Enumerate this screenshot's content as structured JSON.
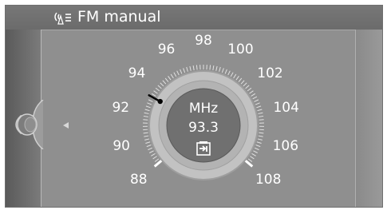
{
  "header": {
    "title": "FM manual",
    "icon": "radio-signal-icon"
  },
  "dial": {
    "unit": "MHz",
    "frequency": "93.3",
    "current_frequency_value": 93.3,
    "scale_labels": [
      "88",
      "90",
      "92",
      "94",
      "96",
      "98",
      "100",
      "102",
      "104",
      "106",
      "108"
    ],
    "scale_min": 88,
    "scale_max": 108,
    "store_icon": "store-preset-icon"
  },
  "colors": {
    "background": "#8f8f8f",
    "dial_face": "#bdbdbd",
    "dial_center": "#6e6e6e",
    "pointer": "#000000"
  },
  "icons": {
    "left_control": "rotary-knob-icon",
    "back": "back-arrow-icon"
  }
}
